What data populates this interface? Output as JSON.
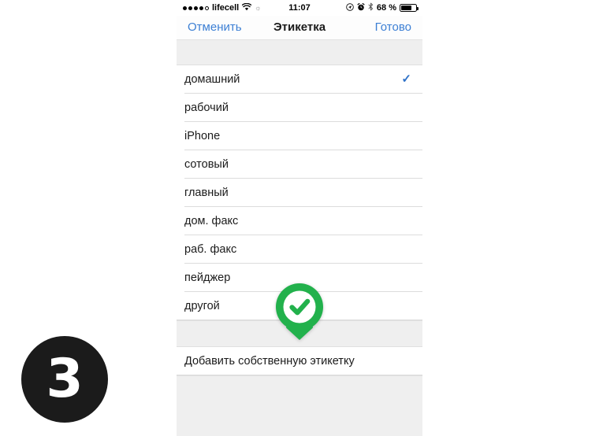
{
  "status_bar": {
    "signal_dots_filled": 4,
    "signal_dots_empty": 1,
    "carrier": "lifecell",
    "wifi_icon": "wifi-icon",
    "sun_icon": "sun-icon",
    "location_icon": "location-arrow-icon",
    "alarm_icon": "alarm-clock-icon",
    "bluetooth_icon": "bluetooth-icon",
    "time": "11:07",
    "battery_percent": "68 %",
    "battery_icon": "battery-icon"
  },
  "nav_bar": {
    "cancel_label": "Отменить",
    "title": "Этикетка",
    "done_label": "Готово",
    "tint_color": "#3c7fd4"
  },
  "list": {
    "rows": [
      {
        "label": "домашний",
        "checked": true,
        "check_glyph": "✓"
      },
      {
        "label": "рабочий",
        "checked": false,
        "check_glyph": ""
      },
      {
        "label": "iPhone",
        "checked": false,
        "check_glyph": ""
      },
      {
        "label": "сотовый",
        "checked": false,
        "check_glyph": ""
      },
      {
        "label": "главный",
        "checked": false,
        "check_glyph": ""
      },
      {
        "label": "дом. факс",
        "checked": false,
        "check_glyph": ""
      },
      {
        "label": "раб. факс",
        "checked": false,
        "check_glyph": ""
      },
      {
        "label": "пейджер",
        "checked": false,
        "check_glyph": ""
      },
      {
        "label": "другой",
        "checked": false,
        "check_glyph": ""
      }
    ],
    "add_custom_label": "Добавить собственную этикетку"
  },
  "annotations": {
    "pin_marker": {
      "icon": "green-check-pin-marker",
      "color": "#22b14c",
      "check_color": "#ffffff"
    },
    "step_badge": {
      "number": "3",
      "background": "#1b1b1b",
      "text_color": "#ffffff"
    }
  }
}
